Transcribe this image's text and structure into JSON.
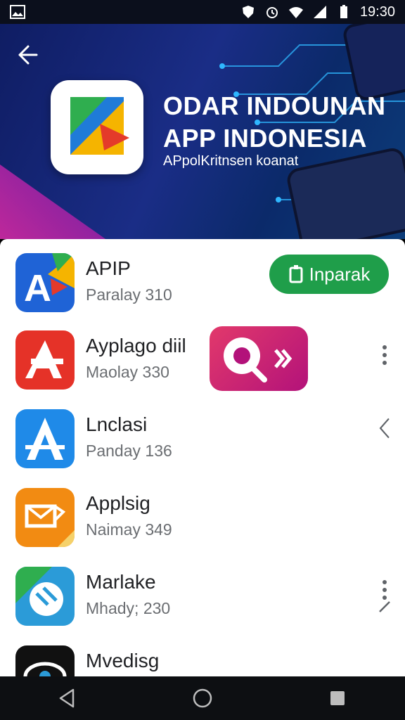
{
  "status_bar": {
    "time": "19:30",
    "icons": [
      "gallery-icon",
      "shield-icon",
      "alarm-icon",
      "wifi-icon",
      "signal-icon",
      "battery-icon"
    ]
  },
  "hero": {
    "title_line1": "ODAR INDOUNAN",
    "title_line2": "APP INDONESIA",
    "subtitle": "APpolKritnsen koanat"
  },
  "apps": [
    {
      "name": "APIP",
      "sub": "Paralay 310",
      "action": "Inparak"
    },
    {
      "name": "Ayplago diil",
      "sub": "Maolay 330"
    },
    {
      "name": "Lnclasi",
      "sub": "Panday 136"
    },
    {
      "name": "Applsig",
      "sub": "Naimay 349"
    },
    {
      "name": "Marlake",
      "sub": "Mhady; 230"
    },
    {
      "name": "Mvedisg",
      "sub": ""
    }
  ],
  "colors": {
    "install_green": "#1f9e4a",
    "hero_blue": "#1a2d86",
    "accent_pink": "#b0208f"
  }
}
